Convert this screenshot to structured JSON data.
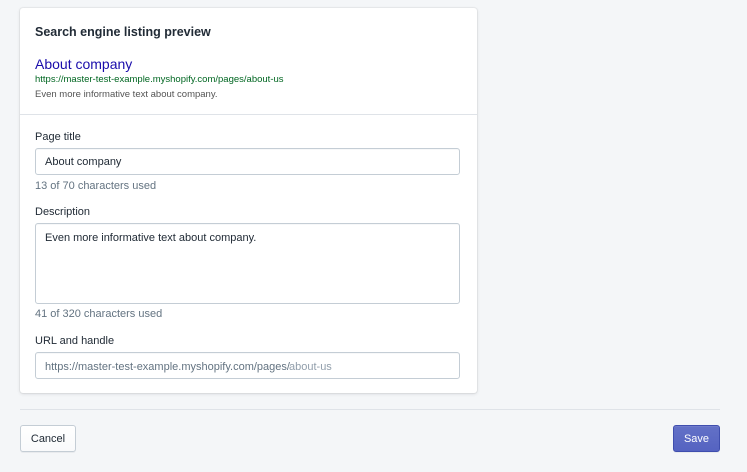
{
  "card": {
    "title": "Search engine listing preview"
  },
  "preview": {
    "title": "About company",
    "url": "https://master-test-example.myshopify.com/pages/about-us",
    "description": "Even more informative text about company."
  },
  "page_title": {
    "label": "Page title",
    "value": "About company",
    "help": "13 of 70 characters used"
  },
  "description": {
    "label": "Description",
    "value": "Even more informative text about company.",
    "help": "41 of 320 characters used"
  },
  "url_handle": {
    "label": "URL and handle",
    "prefix": "https://master-test-example.myshopify.com/pages/",
    "value": "about-us"
  },
  "actions": {
    "cancel_label": "Cancel",
    "save_label": "Save"
  },
  "colors": {
    "primary": "#5c6ac4",
    "link": "#1a0dab",
    "url_green": "#006621",
    "background": "#f4f6f8"
  }
}
